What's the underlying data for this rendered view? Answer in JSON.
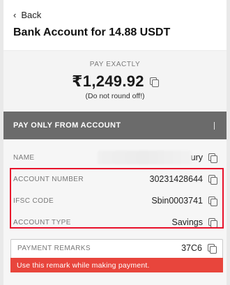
{
  "nav": {
    "back_label": "Back"
  },
  "header": {
    "title": "Bank Account for 14.88 USDT"
  },
  "pay": {
    "label": "PAY EXACTLY",
    "amount": "₹1,249.92",
    "note": "(Do not round off!)"
  },
  "account_section": {
    "label": "PAY ONLY FROM ACCOUNT"
  },
  "details": {
    "name_label": "NAME",
    "name_value_visible": "ury",
    "account_number_label": "ACCOUNT NUMBER",
    "account_number_value": "30231428644",
    "ifsc_label": "IFSC CODE",
    "ifsc_value": "Sbin0003741",
    "account_type_label": "ACCOUNT TYPE",
    "account_type_value": "Savings"
  },
  "remarks": {
    "label": "PAYMENT REMARKS",
    "value": "37C6",
    "warning": "Use this remark while making payment."
  },
  "colors": {
    "highlight": "#e8102a",
    "warning_bg": "#e8453c",
    "section_bar": "#6b6b6b"
  },
  "icons": [
    "chevron-left-icon",
    "copy-icon"
  ]
}
